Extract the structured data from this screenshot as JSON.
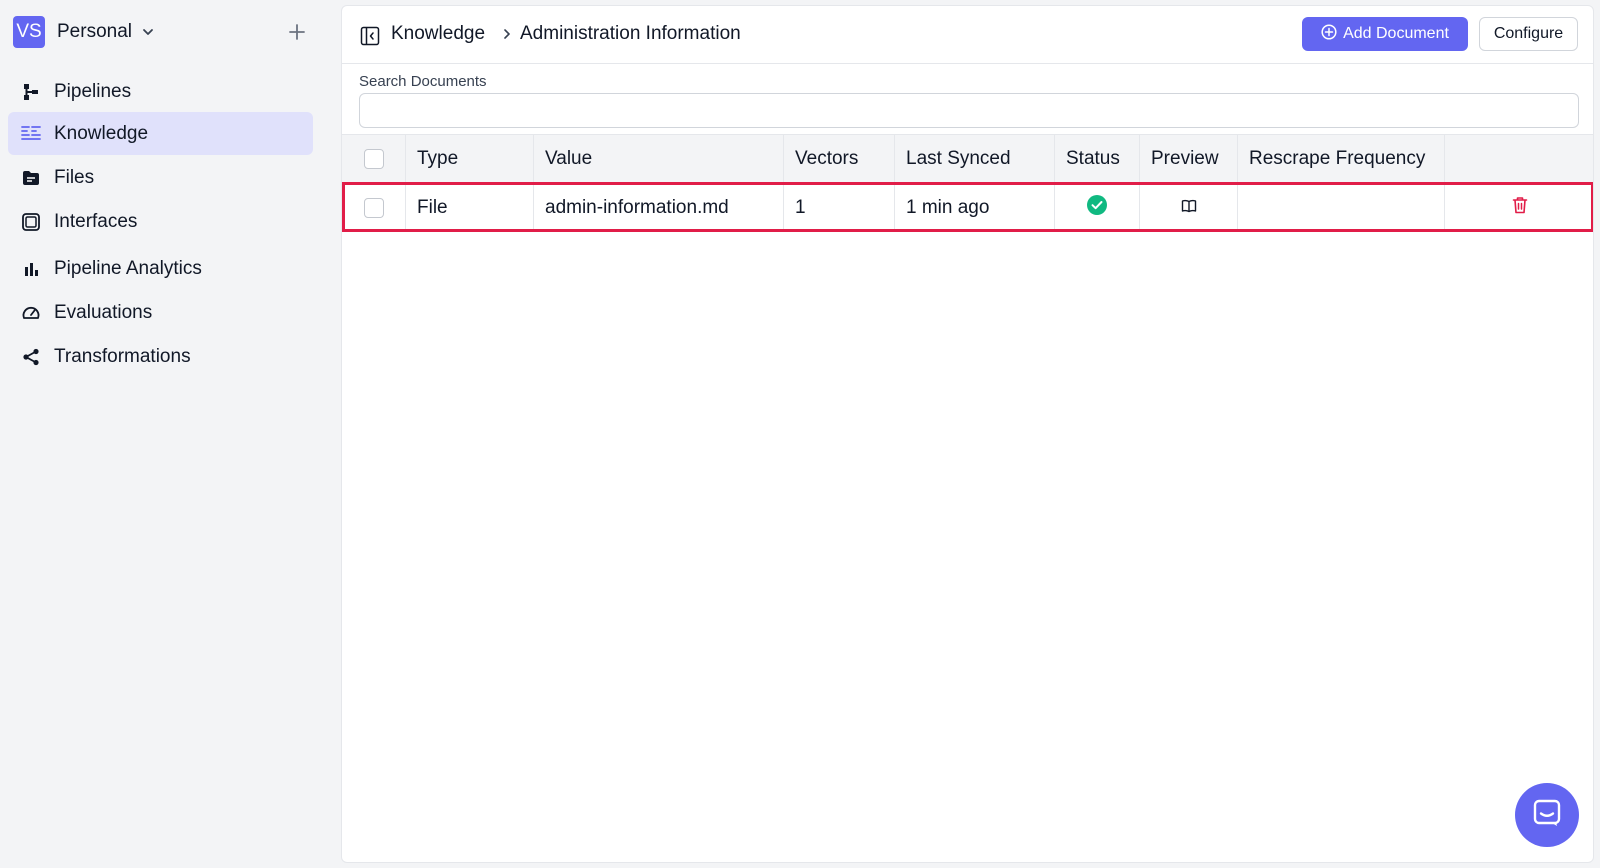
{
  "workspace": {
    "initials": "VS",
    "name": "Personal"
  },
  "sidebar": {
    "items": [
      {
        "label": "Pipelines",
        "icon": "pipelines-icon"
      },
      {
        "label": "Knowledge",
        "icon": "knowledge-icon",
        "active": true
      },
      {
        "label": "Files",
        "icon": "files-icon"
      },
      {
        "label": "Interfaces",
        "icon": "interfaces-icon"
      },
      {
        "label": "Pipeline Analytics",
        "icon": "bar-chart-icon"
      },
      {
        "label": "Evaluations",
        "icon": "gauge-icon"
      },
      {
        "label": "Transformations",
        "icon": "share-icon"
      }
    ]
  },
  "header": {
    "breadcrumb": [
      "Knowledge",
      "Administration Information"
    ],
    "add_document_label": "Add Document",
    "configure_label": "Configure"
  },
  "search": {
    "label": "Search Documents",
    "value": "",
    "placeholder": ""
  },
  "table": {
    "columns": [
      "Type",
      "Value",
      "Vectors",
      "Last Synced",
      "Status",
      "Preview",
      "Rescrape Frequency"
    ],
    "rows": [
      {
        "type": "File",
        "value": "admin-information.md",
        "vectors": "1",
        "last_synced": "1 min ago",
        "status": "synced",
        "preview": "book-icon",
        "rescrape_frequency": ""
      }
    ]
  },
  "colors": {
    "accent": "#6366f1",
    "active_nav_bg": "#e0e1fb",
    "status_ok": "#10b981",
    "delete": "#e11d48",
    "highlight": "#e11d48"
  }
}
